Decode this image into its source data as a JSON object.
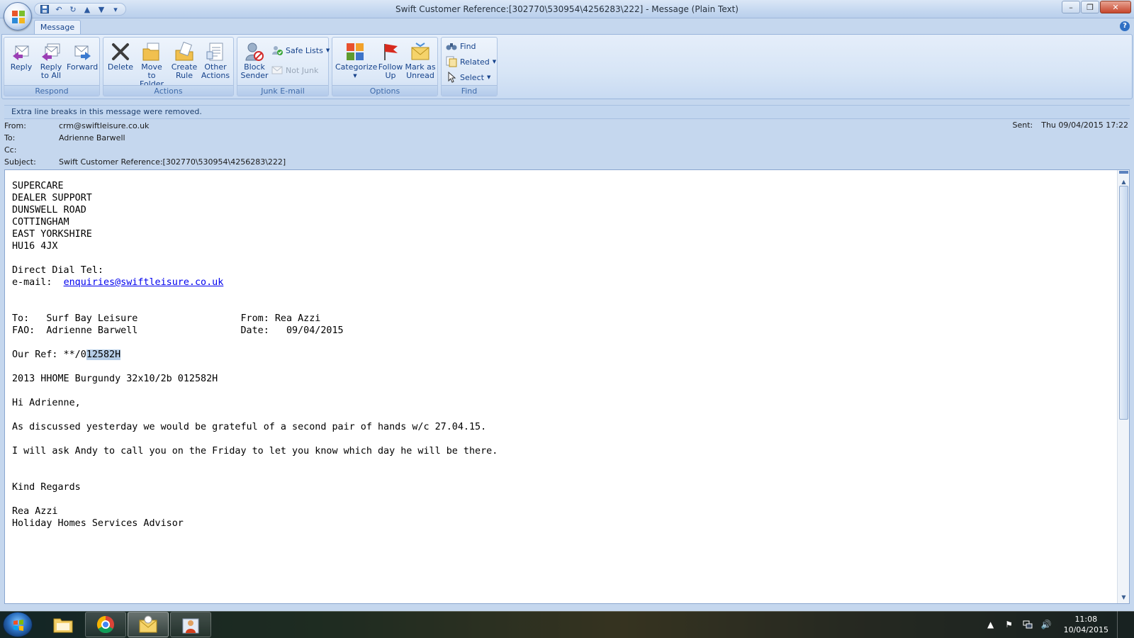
{
  "window": {
    "title": "Swift Customer Reference:[302770\\530954\\4256283\\222] - Message (Plain Text)",
    "minimize": "–",
    "maximize": "❐",
    "close": "✕"
  },
  "ribbon": {
    "tab": "Message",
    "groups": {
      "respond": {
        "label": "Respond",
        "reply": "Reply",
        "reply_all_1": "Reply",
        "reply_all_2": "to All",
        "forward": "Forward"
      },
      "actions": {
        "label": "Actions",
        "delete": "Delete",
        "move_1": "Move to",
        "move_2": "Folder",
        "rule_1": "Create",
        "rule_2": "Rule",
        "other_1": "Other",
        "other_2": "Actions"
      },
      "junk": {
        "label": "Junk E-mail",
        "block_1": "Block",
        "block_2": "Sender",
        "safe_lists": "Safe Lists",
        "not_junk": "Not Junk"
      },
      "options": {
        "label": "Options",
        "categorize": "Categorize",
        "follow_1": "Follow",
        "follow_2": "Up",
        "mark_1": "Mark as",
        "mark_2": "Unread"
      },
      "find": {
        "label": "Find",
        "find": "Find",
        "related": "Related",
        "select": "Select"
      }
    }
  },
  "infobar": "Extra line breaks in this message were removed.",
  "header": {
    "from_label": "From:",
    "from": "crm@swiftleisure.co.uk",
    "to_label": "To:",
    "to": "Adrienne Barwell",
    "cc_label": "Cc:",
    "cc": "",
    "subject_label": "Subject:",
    "subject": "Swift Customer Reference:[302770\\530954\\4256283\\222]",
    "sent_label": "Sent:",
    "sent": "Thu 09/04/2015 17:22"
  },
  "body": {
    "address": [
      "SUPERCARE",
      "DEALER SUPPORT",
      "DUNSWELL ROAD",
      "COTTINGHAM",
      "EAST YORKSHIRE",
      "HU16 4JX"
    ],
    "direct_dial": "Direct Dial Tel:",
    "email_label": "e-mail:  ",
    "email_link": "enquiries@swiftleisure.co.uk",
    "to_line": "To:   Surf Bay Leisure                  From: Rea Azzi",
    "fao_line": "FAO:  Adrienne Barwell                  Date:   09/04/2015",
    "ref_prefix": "Our Ref: **/0",
    "ref_selected": "12582H",
    "model_line": "2013 HHOME Burgundy 32x10/2b 012582H",
    "greeting": "Hi Adrienne,",
    "para1": "As discussed yesterday we would be grateful of a second pair of hands w/c 27.04.15.",
    "para2": "I will ask Andy to call you on the Friday to let you know which day he will be there.",
    "closing": "Kind Regards",
    "sig_name": "Rea Azzi",
    "sig_title": "Holiday Homes Services Advisor"
  },
  "taskbar": {
    "clock_time": "11:08",
    "clock_date": "10/04/2015",
    "tray_icons": [
      "show-hidden-icon",
      "action-center-flag-icon",
      "network-icon",
      "volume-icon"
    ]
  },
  "colors": {
    "ribbon_text": "#15428b",
    "link": "#0000ee",
    "selection": "#b5cde6"
  }
}
